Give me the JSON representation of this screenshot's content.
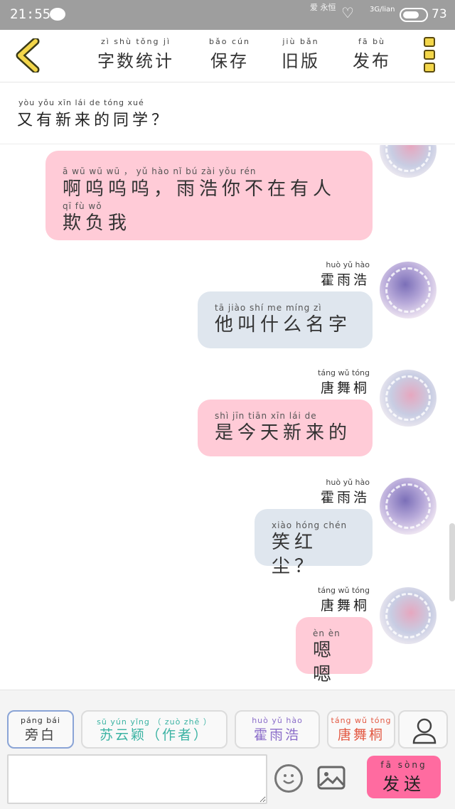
{
  "status_bar": {
    "time": "21:55",
    "decor_text": "爱 永恒",
    "network": "3G/lian",
    "battery": "73"
  },
  "nav": {
    "items": [
      {
        "pinyin": "zì shù tǒng jì",
        "label": "字数统计"
      },
      {
        "pinyin": "bǎo cún",
        "label": "保存"
      },
      {
        "pinyin": "jiù bǎn",
        "label": "旧版"
      },
      {
        "pinyin": "fā bù",
        "label": "发布"
      }
    ]
  },
  "chat_title": {
    "pinyin": "yòu yǒu xīn lái de tóng xué",
    "text": "又有新来的同学？"
  },
  "messages": [
    {
      "sender_pinyin": "",
      "sender": "",
      "style": "pink",
      "lines": [
        {
          "pinyin": "ā wū wū wū ， yǔ hào nǐ bú zài yǒu rén",
          "text": "啊呜呜呜，雨浩你不在有人"
        },
        {
          "pinyin": "qī fù wǒ",
          "text": "欺负我"
        }
      ]
    },
    {
      "sender_pinyin": "huò yǔ hào",
      "sender": "霍雨浩",
      "style": "blue",
      "lines": [
        {
          "pinyin": "tā jiào shí me míng zì",
          "text": "他叫什么名字"
        }
      ]
    },
    {
      "sender_pinyin": "táng wǔ tóng",
      "sender": "唐舞桐",
      "style": "pink",
      "lines": [
        {
          "pinyin": "shì jīn tiān xīn lái de",
          "text": "是今天新来的"
        }
      ]
    },
    {
      "sender_pinyin": "huò yǔ hào",
      "sender": "霍雨浩",
      "style": "blue",
      "lines": [
        {
          "pinyin": "xiào hóng chén",
          "text": "笑红尘？"
        }
      ]
    },
    {
      "sender_pinyin": "táng wǔ tóng",
      "sender": "唐舞桐",
      "style": "pink",
      "lines": [
        {
          "pinyin": "èn èn",
          "text": "嗯嗯"
        }
      ]
    }
  ],
  "roles": [
    {
      "pinyin": "páng bái",
      "label": "旁白",
      "color": "#444444"
    },
    {
      "pinyin": "sū yún yǐng （ zuò zhě ）",
      "label": "苏云颖（作者）",
      "color": "#3bb3a3"
    },
    {
      "pinyin": "huò yǔ hào",
      "label": "霍雨浩",
      "color": "#8a6cc9"
    },
    {
      "pinyin": "táng wǔ tóng",
      "label": "唐舞桐",
      "color": "#e35a44"
    }
  ],
  "composer": {
    "input_value": "",
    "send_pinyin": "fā sòng",
    "send_label": "发送",
    "send_color": "#ff6ba0"
  },
  "icons": [
    "back-chevron-icon",
    "menu-icon",
    "user-icon",
    "emoji-icon",
    "image-icon"
  ]
}
